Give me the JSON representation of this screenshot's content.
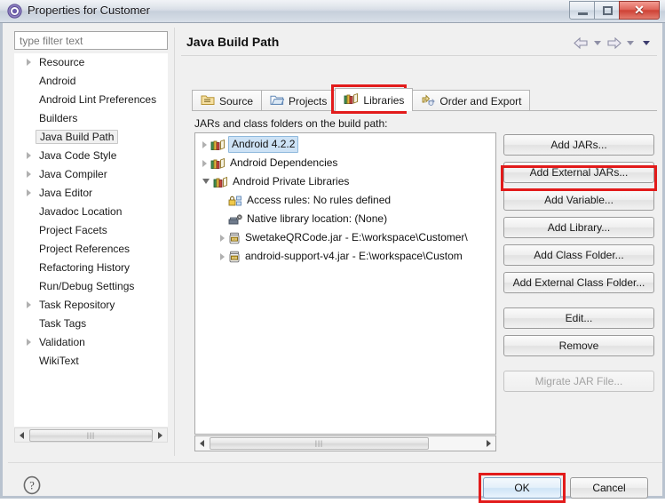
{
  "window": {
    "title": "Properties for Customer",
    "icon": "eclipse-properties-icon",
    "controls": {
      "minimize": "minimize-icon",
      "maximize": "maximize-icon",
      "close": "✕"
    }
  },
  "sidebar": {
    "filter": {
      "placeholder": "type filter text",
      "value": ""
    },
    "items": [
      {
        "label": "Resource",
        "expandable": true,
        "selected": false
      },
      {
        "label": "Android",
        "expandable": false,
        "selected": false
      },
      {
        "label": "Android Lint Preferences",
        "expandable": false,
        "selected": false
      },
      {
        "label": "Builders",
        "expandable": false,
        "selected": false
      },
      {
        "label": "Java Build Path",
        "expandable": false,
        "selected": true
      },
      {
        "label": "Java Code Style",
        "expandable": true,
        "selected": false
      },
      {
        "label": "Java Compiler",
        "expandable": true,
        "selected": false
      },
      {
        "label": "Java Editor",
        "expandable": true,
        "selected": false
      },
      {
        "label": "Javadoc Location",
        "expandable": false,
        "selected": false
      },
      {
        "label": "Project Facets",
        "expandable": false,
        "selected": false
      },
      {
        "label": "Project References",
        "expandable": false,
        "selected": false
      },
      {
        "label": "Refactoring History",
        "expandable": false,
        "selected": false
      },
      {
        "label": "Run/Debug Settings",
        "expandable": false,
        "selected": false
      },
      {
        "label": "Task Repository",
        "expandable": true,
        "selected": false
      },
      {
        "label": "Task Tags",
        "expandable": false,
        "selected": false
      },
      {
        "label": "Validation",
        "expandable": true,
        "selected": false
      },
      {
        "label": "WikiText",
        "expandable": false,
        "selected": false
      }
    ]
  },
  "page": {
    "title": "Java Build Path",
    "nav": {
      "back": "back-arrow-icon",
      "back_menu": "chevron-down-icon",
      "forward": "forward-arrow-icon",
      "forward_menu": "chevron-down-icon",
      "view_menu": "chevron-down-icon"
    },
    "tabs": [
      {
        "label": "Source",
        "icon": "source-folder-icon",
        "active": false
      },
      {
        "label": "Projects",
        "icon": "projects-folder-icon",
        "active": false
      },
      {
        "label": "Libraries",
        "icon": "libraries-books-icon",
        "active": true
      },
      {
        "label": "Order and Export",
        "icon": "order-export-icon",
        "active": false
      }
    ],
    "panel_label": "JARs and class folders on the build path:",
    "tree": [
      {
        "label": "Android 4.2.2",
        "icon": "library-books-icon",
        "indent": 0,
        "arrow": "collapsed",
        "selected": true
      },
      {
        "label": "Android Dependencies",
        "icon": "library-books-icon",
        "indent": 0,
        "arrow": "collapsed",
        "selected": false
      },
      {
        "label": "Android Private Libraries",
        "icon": "library-books-icon",
        "indent": 0,
        "arrow": "expanded",
        "selected": false
      },
      {
        "label": "Access rules: No rules defined",
        "icon": "access-rules-icon",
        "indent": 1,
        "arrow": "none",
        "selected": false
      },
      {
        "label": "Native library location: (None)",
        "icon": "native-library-icon",
        "indent": 1,
        "arrow": "none",
        "selected": false
      },
      {
        "label": "SwetakeQRCode.jar - E:\\workspace\\Customer\\",
        "icon": "jar-icon",
        "indent": 1,
        "arrow": "collapsed",
        "selected": false
      },
      {
        "label": "android-support-v4.jar - E:\\workspace\\Custom",
        "icon": "jar-icon",
        "indent": 1,
        "arrow": "collapsed",
        "selected": false
      }
    ],
    "buttons": [
      {
        "label": "Add JARs...",
        "mnemonic": "J",
        "disabled": false,
        "highlighted": false
      },
      {
        "label": "Add External JARs...",
        "mnemonic": "x",
        "disabled": false,
        "highlighted": true
      },
      {
        "label": "Add Variable...",
        "mnemonic": "V",
        "disabled": false,
        "highlighted": false
      },
      {
        "label": "Add Library...",
        "mnemonic": "a",
        "disabled": false,
        "highlighted": false
      },
      {
        "label": "Add Class Folder...",
        "mnemonic": "C",
        "disabled": false,
        "highlighted": false
      },
      {
        "label": "Add External Class Folder...",
        "mnemonic": "d",
        "disabled": false,
        "highlighted": false
      },
      {
        "label": "Edit...",
        "mnemonic": "E",
        "disabled": false,
        "highlighted": false
      },
      {
        "label": "Remove",
        "mnemonic": "R",
        "disabled": false,
        "highlighted": false
      },
      {
        "label": "Migrate JAR File...",
        "mnemonic": "M",
        "disabled": true,
        "highlighted": false
      }
    ]
  },
  "footer": {
    "help": "help-question-icon",
    "ok": "OK",
    "cancel": "Cancel"
  },
  "highlights": {
    "accent_color": "#e21b1b",
    "targets": [
      "Libraries tab",
      "Add External JARs... button",
      "OK button"
    ]
  },
  "scrollbars": {
    "grip": "|||"
  }
}
